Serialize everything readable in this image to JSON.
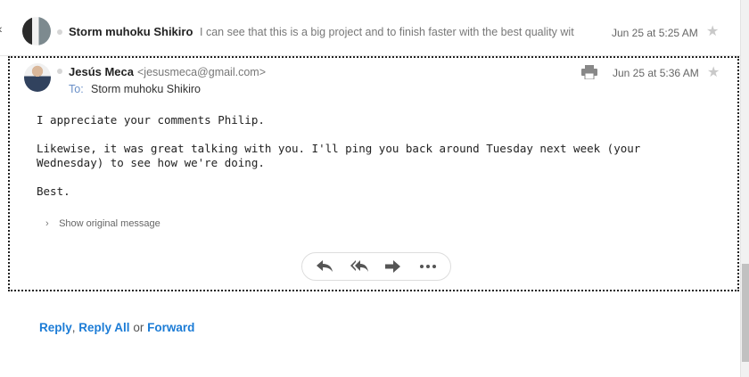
{
  "thread": [
    {
      "sender": "Storm muhoku Shikiro",
      "snippet": "I can see that this is a big project and to finish faster with the best quality wit",
      "date": "Jun 25 at 5:25 AM"
    }
  ],
  "message": {
    "sender": "Jesús Meca",
    "email": "<jesusmeca@gmail.com>",
    "to_label": "To:",
    "to_value": "Storm muhoku Shikiro",
    "date": "Jun 25 at 5:36 AM",
    "body": [
      "I appreciate your comments Philip.",
      "Likewise, it was great talking with you. I'll ping you back around Tuesday next week (your Wednesday) to see how we're doing.",
      "Best."
    ],
    "show_original": "Show original message"
  },
  "actions": {
    "reply": "Reply",
    "comma": ",",
    "reply_all": "Reply All",
    "or": "or",
    "forward": "Forward"
  },
  "icons": [
    "reply-icon",
    "reply-all-icon",
    "forward-icon",
    "more-icon",
    "print-icon",
    "star-icon"
  ]
}
